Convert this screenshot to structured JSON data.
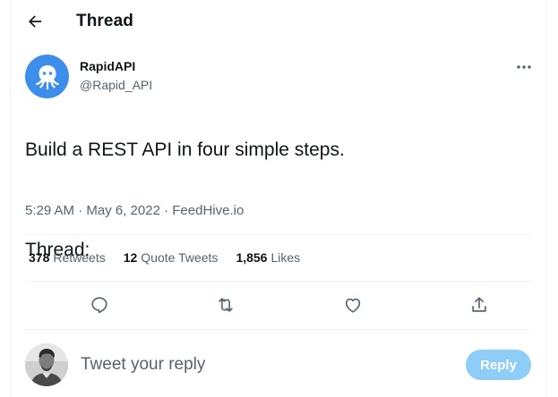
{
  "header": {
    "title": "Thread",
    "back_icon": "arrow-left-icon"
  },
  "tweet": {
    "author": {
      "name": "RapidAPI",
      "handle": "@Rapid_API",
      "avatar_icon": "rapidapi-octopus-icon",
      "avatar_color": "#3d8eea"
    },
    "more_icon": "more-horizontal-icon",
    "text_lines": [
      "Build a REST API in four simple steps.",
      "",
      "Thread:"
    ],
    "timestamp": "5:29 AM · May 6, 2022",
    "separator": " · ",
    "source": "FeedHive.io",
    "stats": {
      "retweets": {
        "count": "378",
        "label": "Retweets"
      },
      "quotes": {
        "count": "12",
        "label": "Quote Tweets"
      },
      "likes": {
        "count": "1,856",
        "label": "Likes"
      }
    },
    "actions": [
      {
        "name": "reply",
        "icon": "reply-bubble-icon"
      },
      {
        "name": "retweet",
        "icon": "retweet-icon"
      },
      {
        "name": "like",
        "icon": "heart-icon"
      },
      {
        "name": "share",
        "icon": "share-icon"
      }
    ]
  },
  "reply_box": {
    "placeholder": "Tweet your reply",
    "button_label": "Reply",
    "button_color": "#8ecdf8"
  },
  "colors": {
    "text": "#0f1419",
    "secondary": "#536471",
    "divider": "#eff3f4"
  }
}
